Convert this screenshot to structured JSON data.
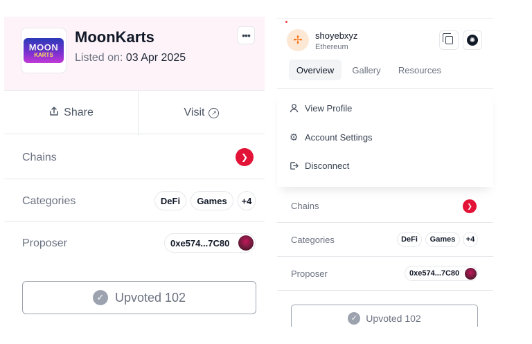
{
  "left": {
    "project": {
      "title": "MoonKarts",
      "listed_prefix": "Listed on:",
      "listed_date": "03 Apr 2025",
      "logo_text_top": "MOON",
      "logo_text_bottom": "KARTS"
    },
    "actions": {
      "share_label": "Share",
      "visit_label": "Visit"
    },
    "rows": {
      "chains_label": "Chains",
      "categories_label": "Categories",
      "categories": [
        "DeFi",
        "Games"
      ],
      "categories_more": "+4",
      "proposer_label": "Proposer",
      "proposer_address": "0xe574...7C80"
    },
    "upvote_label": "Upvoted 102"
  },
  "right": {
    "user": {
      "name": "shoyebxyz",
      "network": "Ethereum"
    },
    "tabs": [
      "Overview",
      "Gallery",
      "Resources"
    ],
    "active_tab": "Overview",
    "menu": [
      "View Profile",
      "Account Settings",
      "Disconnect"
    ],
    "rows": {
      "chains_label": "Chains",
      "categories_label": "Categories",
      "categories": [
        "DeFi",
        "Games"
      ],
      "categories_more": "+4",
      "proposer_label": "Proposer",
      "proposer_address": "0xe574...7C80"
    },
    "upvote_label": "Upvoted 102"
  },
  "colors": {
    "header_bg": "#fdf3f8",
    "hive_red": "#e31337",
    "border": "#e5e7eb",
    "muted_text": "#6b7280",
    "upvote_gray": "#9ca3af"
  },
  "icons": {
    "share": "share-icon",
    "visit": "external-link-icon",
    "chain": "hive-icon",
    "upvote": "check-circle-icon",
    "more": "more-horizontal-icon"
  }
}
